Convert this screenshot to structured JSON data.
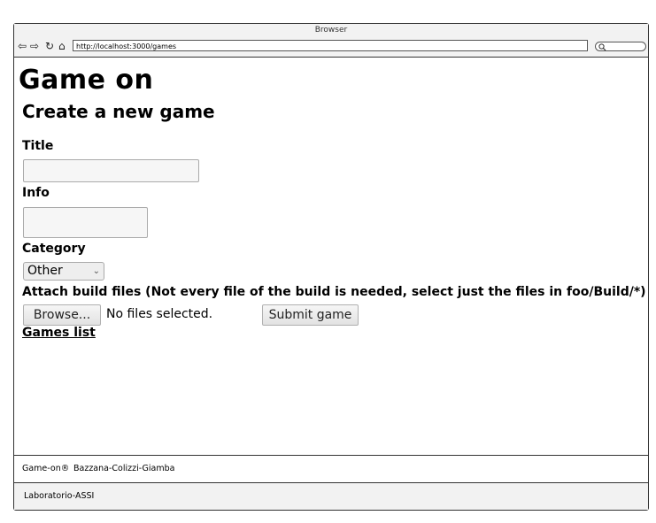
{
  "browser": {
    "title": "Browser",
    "url": "http://localhost:3000/games"
  },
  "page": {
    "heading": "Game on",
    "subheading": "Create a new game"
  },
  "form": {
    "title_label": "Title",
    "title_value": "",
    "info_label": "Info",
    "info_value": "",
    "category_label": "Category",
    "category_selected": "Other",
    "attach_label": "Attach build files (Not every file of the build is needed, select just the files in foo/Build/*)",
    "browse_button": "Browse...",
    "file_status": "No files selected.",
    "submit_button": "Submit game"
  },
  "links": {
    "games_list": "Games list"
  },
  "footer": {
    "brand": "Game-on®",
    "authors": "Bazzana-Colizzi-Giamba",
    "lab": "Laboratorio-ASSI"
  },
  "icons": [
    "back-icon",
    "forward-icon",
    "reload-icon",
    "home-icon",
    "search-icon"
  ]
}
